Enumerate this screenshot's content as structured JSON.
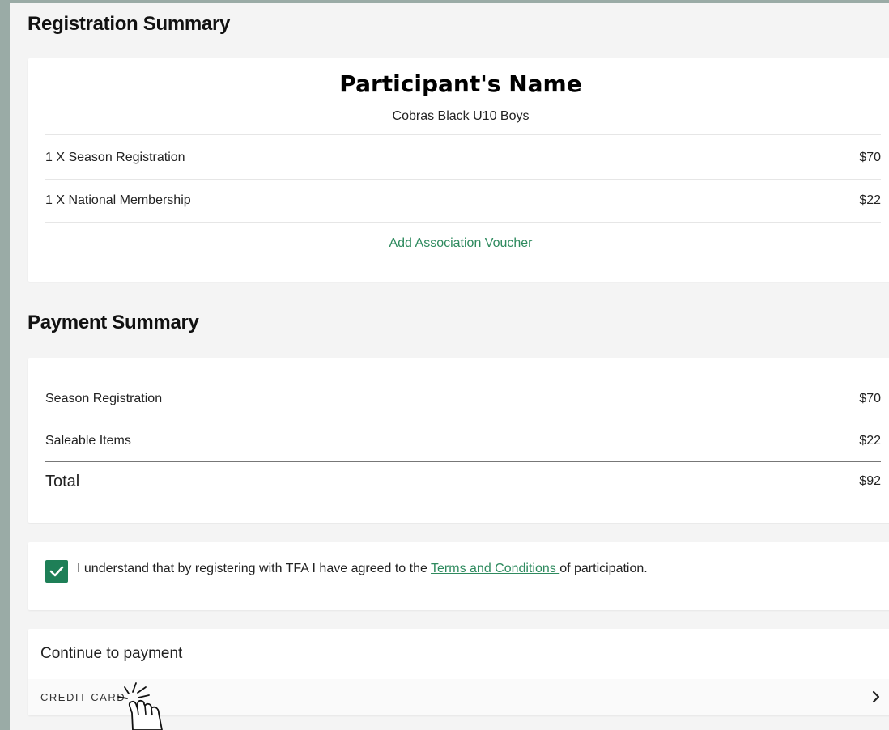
{
  "registration": {
    "title": "Registration Summary",
    "participant_name": "Participant's  Name",
    "team": "Cobras Black U10 Boys",
    "items": [
      {
        "label": "1 X Season Registration",
        "amount": "$70"
      },
      {
        "label": "1 X National Membership",
        "amount": "$22"
      }
    ],
    "voucher_link": "Add Association Voucher"
  },
  "payment": {
    "title": "Payment Summary",
    "items": [
      {
        "label": "Season Registration",
        "amount": "$70"
      },
      {
        "label": "Saleable Items",
        "amount": "$22"
      }
    ],
    "total_label": "Total",
    "total_amount": "$92"
  },
  "terms": {
    "checked": true,
    "text_before": "I understand that by registering with TFA I have agreed to the ",
    "link": "Terms and Conditions ",
    "text_after": "of participation."
  },
  "checkout": {
    "title": "Continue to payment",
    "method": "CREDIT CARD"
  },
  "colors": {
    "accent": "#1e7f57",
    "link": "#2e8a5e",
    "frame": "#9aaba6"
  },
  "icons": [
    "check-icon",
    "chevron-right-icon",
    "pointer-hand-icon"
  ]
}
